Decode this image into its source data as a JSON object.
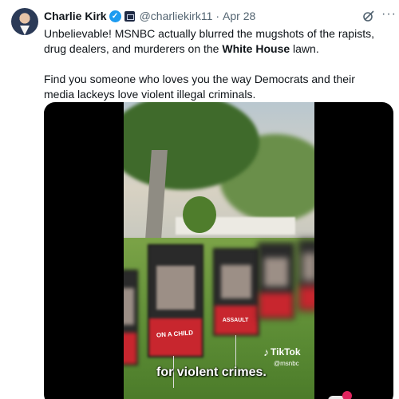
{
  "tweet": {
    "author_name": "Charlie Kirk",
    "handle": "@charliekirk11",
    "separator": "·",
    "date": "Apr 28",
    "verified_glyph": "✓",
    "text_line1_a": "Unbelievable! MSNBC actually blurred the mugshots of the rapists, drug dealers, and murderers on the ",
    "text_line1_bold": "White House",
    "text_line1_b": " lawn.",
    "text_paragraph2": "Find you someone who loves you the way Democrats and their media lackeys love violent illegal criminals.",
    "more_glyph": "···"
  },
  "media": {
    "sign_label": "ON A CHILD",
    "sign_label2": "ASSAULT",
    "watermark": "TikTok",
    "watermark_handle": "@msnbc",
    "caption": "for violent crimes."
  },
  "icons": {
    "grok": "grok-icon",
    "more": "more-icon",
    "verified": "verified-icon",
    "affiliate": "affiliate-icon",
    "tiktok": "tiktok-icon"
  },
  "colors": {
    "verified_blue": "#1d9bf0",
    "text_primary": "#0f1419",
    "text_secondary": "#536471",
    "sign_red": "#c8262e"
  }
}
